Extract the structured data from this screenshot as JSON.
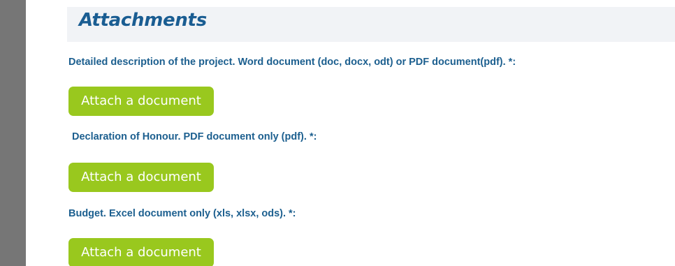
{
  "colors": {
    "title": "#1a5d92",
    "label": "#1c5f8f",
    "button_bg": "#99c81e",
    "button_text": "#ffffff",
    "header_band": "#f1f3f6",
    "left_bar": "#767676"
  },
  "section": {
    "title": "Attachments"
  },
  "fields": [
    {
      "label": "Detailed description of the project. Word document (doc, docx, odt) or PDF document(pdf). *:",
      "button_label": "Attach a document"
    },
    {
      "label": "Declaration of Honour. PDF document only (pdf). *:",
      "button_label": "Attach a document"
    },
    {
      "label": "Budget. Excel document only (xls, xlsx, ods). *:",
      "button_label": "Attach a document"
    }
  ]
}
